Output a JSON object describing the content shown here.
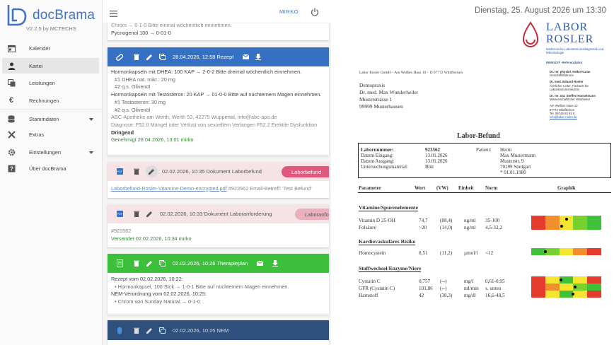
{
  "app": {
    "name": "docBrama",
    "version": "V2.2.5 by MCTECHS",
    "user": "MIRKO"
  },
  "sidebar": {
    "items": [
      {
        "label": "Kalender",
        "icon": "calendar-icon"
      },
      {
        "label": "Kartei",
        "icon": "person-icon"
      },
      {
        "label": "Leistungen",
        "icon": "copy-icon"
      },
      {
        "label": "Rechnungen",
        "icon": "euro-icon"
      },
      {
        "label": "Stammdaten",
        "icon": "database-icon"
      },
      {
        "label": "Extras",
        "icon": "tools-icon"
      },
      {
        "label": "Einstellungen",
        "icon": "gear-icon"
      },
      {
        "label": "Über docBrama",
        "icon": "help-icon"
      }
    ]
  },
  "feed": {
    "top_lines": [
      "Chrom → 0-1-0 Bitte einmal wöchentlich einnehmen.",
      "Pycnogenol 100 → 0-01-0"
    ],
    "rezept": {
      "header": "28.04.2026, 12:58 Rezept",
      "lines": [
        "Hormonkapseln mit DHEA: 100 KAP → 2-0-2 Bitte dreimal wöchentlich einnehmen.",
        "#1 DHEA nat. mikr.: 20 mg",
        "#2 q.s. Olivenöl",
        "Hormonkapseln mit Testosteron: 20 KAP → 01-0-0 Bitte auf nüchternem Magen einnehmen.",
        "#1 Testosteron: 30 mg",
        "#2 q.s. Olivenöl",
        "ABC-Apotheke am Werth, Werth 53, 42275 Wuppertal, info@abc-apo.de",
        "Diagnose: F52.0 Mangel oder Verlust von sexuellem Verlangen F52.2 Erektile Dysfunktion",
        "Dringend",
        "Genehmigt 28.04.2026, 13:01 mirko"
      ]
    },
    "laborbefund": {
      "header": "02.02.2026, 10:35 Dokument Laborbefund",
      "pill": "Laborbefund",
      "link": "Laborbefund-Rosler-Vitamine-Demo-encrypted.pdf",
      "extra": "#923562 Email-Betreff: 'Test Befund'"
    },
    "laboranforderung": {
      "header": "02.02.2026, 10:33 Dokument Laboranforderung",
      "pill": "Laboranforderung",
      "lines": [
        "#923562",
        "Versendet 02.02.2026, 10:34 mirko"
      ]
    },
    "therapieplan": {
      "header": "02.02.2026, 10:26 Therapieplan",
      "lines": [
        "Rezept vom 02.02.2026, 10:22:",
        "Hormonkapsel, 100 Stck → 1-0-1 Bitte auf nüchternem Magen einnehmen.",
        "NEM-Verordnung vom 02.02.2026, 10:25:",
        "Chrom von Sunday Natural → 0-1-0"
      ]
    },
    "nem": {
      "header": "02.02.2026, 10:25 NEM"
    }
  },
  "document": {
    "datetime": "Dienstag, 25. August 2026 um 13:30",
    "lab_name_1": "LABOR",
    "lab_name_2": "ROSLER",
    "lab_sub": "Medizinische Laboratoriumsdiagnostik und Mikrobiologie",
    "lab_ref": "RIMKUS® -Referenzlabor",
    "staff": [
      {
        "name": "Dr. rer. physiol. Heiko Kuran",
        "role": "Geschäftsführerin"
      },
      {
        "name": "Dr. med. Eduard Rosler",
        "role": "Ärztlicher Leiter, Facharzt für Laboratoriumsmedizin"
      },
      {
        "name": "Dr. rer. nat. Steffen Hanselmann",
        "role": "Wissenschaftlicher Mitarbeiter"
      }
    ],
    "lab_address": [
      "Am Weißen Haus 10",
      "97772 Wildflecken",
      "Tel. 09745 93 91 0",
      "info@labor-rosler.de"
    ],
    "sender_line": "Labor Rosler GmbH – Am Weißen Haus 10 – D 97772 Wildflecken",
    "recipient": [
      "Demopraxis",
      "Dr. med. Max Wunderheiler",
      "Musterstrasse 1",
      "99999 Musterhausen"
    ],
    "title": "Labor-Befund",
    "info": {
      "labels": [
        "Labornummer:",
        "Datum Eingang:",
        "Datum Ausgang:",
        "Untersuchungsmaterial:"
      ],
      "values": [
        "923562",
        "13.01.2026",
        "13.01.2026",
        "Blut"
      ],
      "patient_label": "Patient:",
      "patient": [
        "Herrn",
        "Max Mustermann",
        "Musterstr. 9",
        "70199 Stuttgart",
        "* 01.01.1980"
      ]
    },
    "columns": [
      "Parameter",
      "Wert",
      "(VW)",
      "Einheit",
      "Norm",
      "Graphik"
    ],
    "sections": [
      {
        "title": "Vitamine/Spurenelemente",
        "rows": [
          {
            "param": "Vitamin D 25-OH",
            "wert": "74,7",
            "vw": "(88,4)",
            "einheit": "ng/ml",
            "norm": "35-100",
            "marker": 0.5,
            "scheme": "low-bad"
          },
          {
            "param": "Folsäure",
            "wert": ">20",
            "vw": "(14,0)",
            "einheit": "ng/ml",
            "norm": "4,5-32,2",
            "marker": 0.43,
            "scheme": "low-bad"
          }
        ]
      },
      {
        "title": "Kardiovaskuläres Risiko",
        "rows": [
          {
            "param": "Homocystein",
            "wert": "8,51",
            "vw": "(11,2)",
            "einheit": "µmol/l",
            "norm": "<12",
            "marker": 0.2,
            "scheme": "high-bad"
          }
        ]
      },
      {
        "title": "Stoffwechsel/Enzyme/Niere",
        "rows": [
          {
            "param": "Cystatin C",
            "wert": "0,757",
            "vw": "(--)",
            "einheit": "mg/l",
            "norm": "0,61-0,95",
            "marker": 0.42,
            "scheme": "both-bad"
          },
          {
            "param": "GFR (Cystatin C)",
            "wert": "101,86",
            "vw": "(--)",
            "einheit": "ml/min",
            "norm": "s. unten",
            "marker": 0.63,
            "scheme": "low-bad"
          },
          {
            "param": "Harnstoff",
            "wert": "42",
            "vw": "(38,3)",
            "einheit": "mg/dl",
            "norm": "16,6-48,5",
            "marker": 0.6,
            "scheme": "both-bad"
          }
        ]
      }
    ]
  }
}
